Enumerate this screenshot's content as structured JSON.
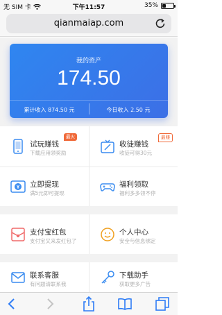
{
  "status_bar": {
    "carrier": "无 SIM 卡",
    "time": "下午11:57",
    "battery": "35%",
    "battery_level": 0.35
  },
  "browser": {
    "url": "qianmaiap.com"
  },
  "asset_card": {
    "title": "我的资产",
    "value": "174.50",
    "total_income": "累计收入 874.50 元",
    "today_income": "今日收入 2.50 元"
  },
  "menu": [
    {
      "label": "试玩赚钱",
      "sub": "下载应用领奖励",
      "badge": "最火",
      "icon": "phone-icon"
    },
    {
      "label": "收徒赚钱",
      "sub": "收徒可得30元",
      "badge": "最赚",
      "icon": "gift-icon"
    },
    {
      "label": "立即提现",
      "sub": "满5元即可提现",
      "icon": "yen-icon"
    },
    {
      "label": "福利领取",
      "sub": "福利多多领不停",
      "icon": "gamepad-icon"
    },
    {
      "label": "支付宝红包",
      "sub": "支付宝又来发红包了",
      "icon": "red-envelope-icon"
    },
    {
      "label": "个人中心",
      "sub": "安全与信息绑定",
      "icon": "smiley-icon"
    },
    {
      "label": "联系客服",
      "sub": "有问题请联系我",
      "icon": "mail-icon"
    },
    {
      "label": "下载助手",
      "sub": "获取更多广告",
      "icon": "key-icon"
    }
  ]
}
